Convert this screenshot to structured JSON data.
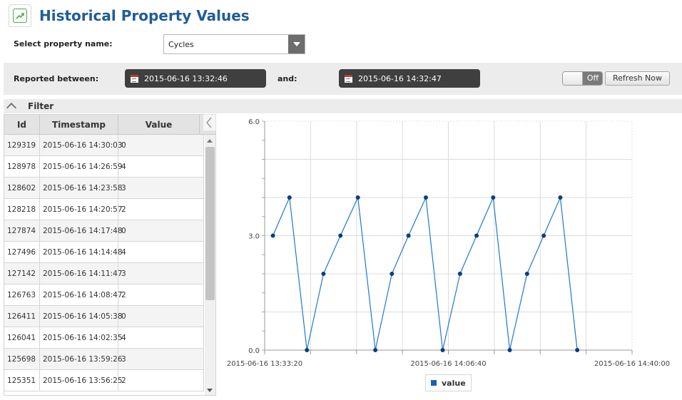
{
  "header": {
    "title": "Historical Property Values",
    "icon": "trend-chart-icon"
  },
  "property": {
    "label": "Select property name:",
    "selected": "Cycles"
  },
  "range": {
    "label": "Reported between:",
    "start": "2015-06-16 13:32:46",
    "and_label": "and:",
    "end": "2015-06-16 14:32:47",
    "auto_refresh_state": "Off",
    "refresh_label": "Refresh Now"
  },
  "filter": {
    "label": "Filter"
  },
  "table": {
    "columns": [
      "Id",
      "Timestamp",
      "Value"
    ],
    "rows": [
      {
        "id": "129319",
        "timestamp": "2015-06-16 14:30:03",
        "value": "0"
      },
      {
        "id": "128978",
        "timestamp": "2015-06-16 14:26:59",
        "value": "4"
      },
      {
        "id": "128602",
        "timestamp": "2015-06-16 14:23:58",
        "value": "3"
      },
      {
        "id": "128218",
        "timestamp": "2015-06-16 14:20:57",
        "value": "2"
      },
      {
        "id": "127874",
        "timestamp": "2015-06-16 14:17:48",
        "value": "0"
      },
      {
        "id": "127496",
        "timestamp": "2015-06-16 14:14:48",
        "value": "4"
      },
      {
        "id": "127142",
        "timestamp": "2015-06-16 14:11:47",
        "value": "3"
      },
      {
        "id": "126763",
        "timestamp": "2015-06-16 14:08:47",
        "value": "2"
      },
      {
        "id": "126411",
        "timestamp": "2015-06-16 14:05:38",
        "value": "0"
      },
      {
        "id": "126041",
        "timestamp": "2015-06-16 14:02:35",
        "value": "4"
      },
      {
        "id": "125698",
        "timestamp": "2015-06-16 13:59:26",
        "value": "3"
      },
      {
        "id": "125351",
        "timestamp": "2015-06-16 13:56:25",
        "value": "2"
      }
    ]
  },
  "colors": {
    "title": "#1f5c99",
    "series": "#1f78d1",
    "marker": "#0b3f7a",
    "legend_swatch": "#1f5fb5"
  },
  "chart_data": {
    "type": "line",
    "title": "",
    "xlabel": "",
    "ylabel": "",
    "ylim": [
      0.0,
      6.0
    ],
    "xlim": [
      "2015-06-16 13:33:20",
      "2015-06-16 14:40:00"
    ],
    "y_tick_labels": [
      "0.0",
      "3.0",
      "6.0"
    ],
    "x_tick_labels": [
      "2015-06-16 13:33:20",
      "2015-06-16 14:06:40",
      "2015-06-16 14:40:00"
    ],
    "grid": true,
    "legend": "bottom-center",
    "series": [
      {
        "name": "value",
        "points": [
          {
            "x": "2015-06-16 13:34:50",
            "y": 3
          },
          {
            "x": "2015-06-16 13:37:50",
            "y": 4
          },
          {
            "x": "2015-06-16 13:41:00",
            "y": 0
          },
          {
            "x": "2015-06-16 13:44:00",
            "y": 2
          },
          {
            "x": "2015-06-16 13:47:05",
            "y": 3
          },
          {
            "x": "2015-06-16 13:50:15",
            "y": 4
          },
          {
            "x": "2015-06-16 13:53:25",
            "y": 0
          },
          {
            "x": "2015-06-16 13:56:25",
            "y": 2
          },
          {
            "x": "2015-06-16 13:59:26",
            "y": 3
          },
          {
            "x": "2015-06-16 14:02:35",
            "y": 4
          },
          {
            "x": "2015-06-16 14:05:38",
            "y": 0
          },
          {
            "x": "2015-06-16 14:08:47",
            "y": 2
          },
          {
            "x": "2015-06-16 14:11:47",
            "y": 3
          },
          {
            "x": "2015-06-16 14:14:48",
            "y": 4
          },
          {
            "x": "2015-06-16 14:17:48",
            "y": 0
          },
          {
            "x": "2015-06-16 14:20:57",
            "y": 2
          },
          {
            "x": "2015-06-16 14:23:58",
            "y": 3
          },
          {
            "x": "2015-06-16 14:26:59",
            "y": 4
          },
          {
            "x": "2015-06-16 14:30:03",
            "y": 0
          }
        ]
      }
    ]
  }
}
